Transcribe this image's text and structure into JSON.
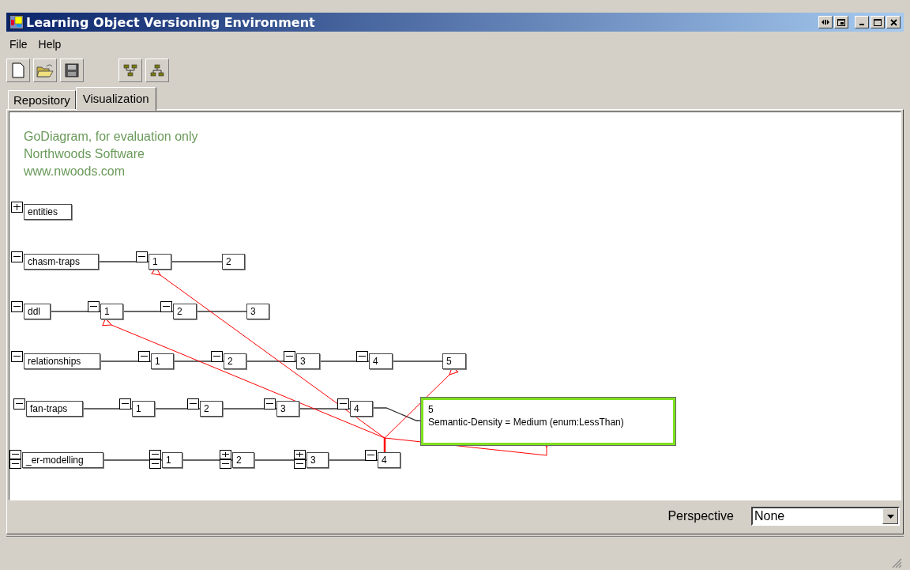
{
  "window": {
    "title": "Learning Object Versioning Environment"
  },
  "menu": [
    "File",
    "Help"
  ],
  "tabs": [
    {
      "label": "Repository",
      "selected": false
    },
    {
      "label": "Visualization",
      "selected": true
    }
  ],
  "evaluation_notice": [
    "GoDiagram, for evaluation only",
    "Northwoods Software",
    "www.nwoods.com"
  ],
  "diagram": {
    "rows": [
      {
        "label": "entities",
        "toggles": [
          {
            "expanded": false
          }
        ]
      },
      {
        "label": "chasm-traps",
        "toggles": [
          {
            "expanded": true
          }
        ],
        "versions": [
          {
            "label": "1",
            "toggles": [
              {
                "expanded": true
              }
            ]
          },
          {
            "label": "2"
          }
        ]
      },
      {
        "label": "ddl",
        "toggles": [
          {
            "expanded": true
          }
        ],
        "versions": [
          {
            "label": "1",
            "toggles": [
              {
                "expanded": true
              }
            ]
          },
          {
            "label": "2",
            "toggles": [
              {
                "expanded": true
              }
            ]
          },
          {
            "label": "3"
          }
        ]
      },
      {
        "label": "relationships",
        "toggles": [
          {
            "expanded": true
          }
        ],
        "versions": [
          {
            "label": "1",
            "toggles": [
              {
                "expanded": true
              }
            ]
          },
          {
            "label": "2",
            "toggles": [
              {
                "expanded": true
              }
            ]
          },
          {
            "label": "3",
            "toggles": [
              {
                "expanded": true
              }
            ]
          },
          {
            "label": "4",
            "toggles": [
              {
                "expanded": true
              }
            ]
          },
          {
            "label": "5"
          }
        ]
      },
      {
        "label": "fan-traps",
        "toggles": [
          {
            "expanded": true
          }
        ],
        "versions": [
          {
            "label": "1",
            "toggles": [
              {
                "expanded": true
              }
            ]
          },
          {
            "label": "2",
            "toggles": [
              {
                "expanded": true
              }
            ]
          },
          {
            "label": "3",
            "toggles": [
              {
                "expanded": true
              }
            ]
          },
          {
            "label": "4",
            "toggles": [
              {
                "expanded": true
              }
            ]
          }
        ]
      },
      {
        "label": "_er-modelling",
        "toggles": [
          {
            "expanded": true
          },
          {
            "expanded": true
          }
        ],
        "versions": [
          {
            "label": "1",
            "toggles": [
              {
                "expanded": true
              },
              {
                "expanded": true
              }
            ]
          },
          {
            "label": "2",
            "toggles": [
              {
                "expanded": false
              },
              {
                "expanded": true
              }
            ]
          },
          {
            "label": "3",
            "toggles": [
              {
                "expanded": false
              },
              {
                "expanded": true
              }
            ]
          },
          {
            "label": "4",
            "toggles": [
              {
                "expanded": true
              }
            ]
          }
        ]
      }
    ],
    "tooltip": [
      "5",
      "Semantic-Density = Medium (enum:LessThan)"
    ]
  },
  "perspective": {
    "label": "Perspective",
    "value": "None"
  }
}
